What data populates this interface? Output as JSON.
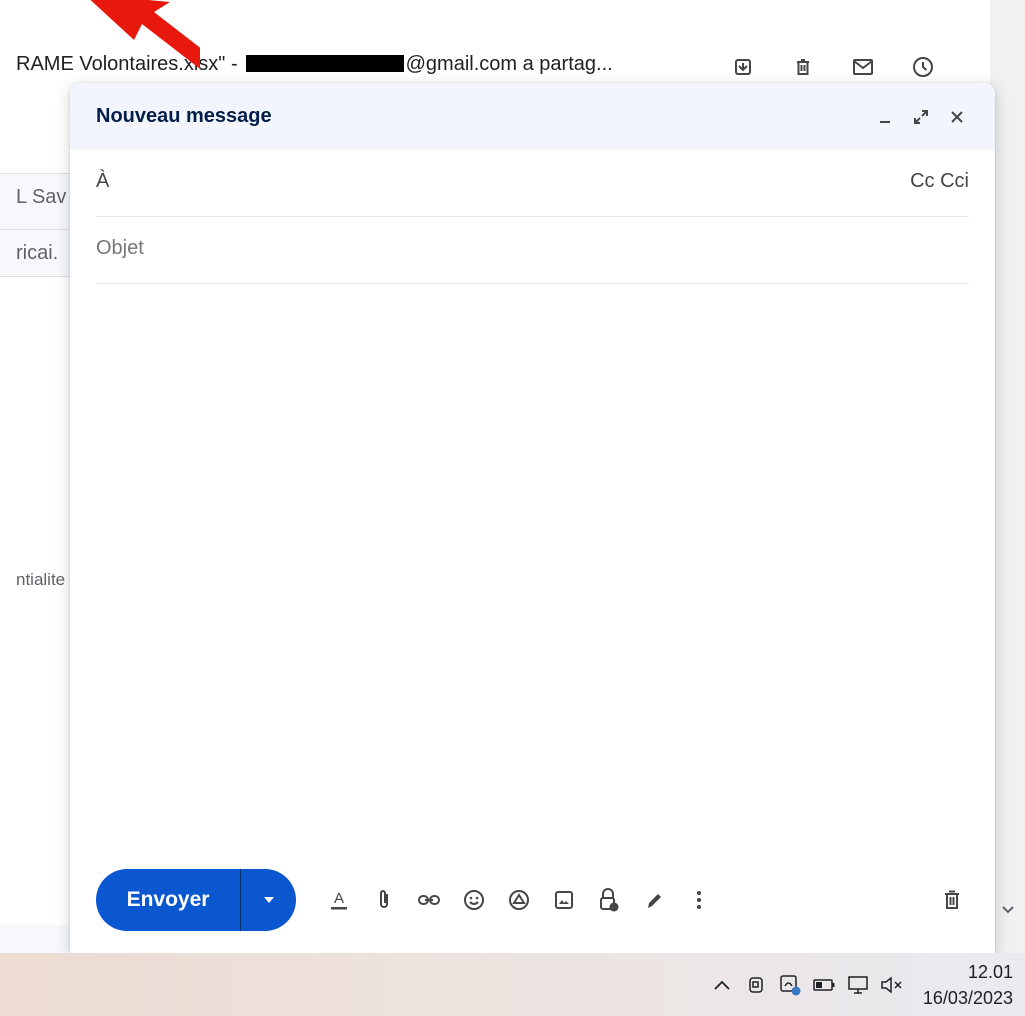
{
  "background": {
    "subject_prefix": "RAME Volontaires.xlsx\" -",
    "subject_suffix": "@gmail.com a partag...",
    "list_rows": [
      "L Sav",
      "ricai."
    ],
    "side_text": "ntialite"
  },
  "compose": {
    "title": "Nouveau message",
    "to_label": "À",
    "cc_cci": "Cc Cci",
    "subject_placeholder": "Objet",
    "send_label": "Envoyer"
  },
  "taskbar": {
    "time": "12.01",
    "date": "16/03/2023"
  },
  "colors": {
    "send_button": "#0b57d0",
    "compose_header": "#f2f6fc",
    "arrow": "#e8180c"
  },
  "icons": {
    "bg_actions": [
      "archive-icon",
      "trash-icon",
      "mail-icon",
      "clock-icon"
    ],
    "compose_header": [
      "minimize-icon",
      "expand-icon",
      "close-icon"
    ],
    "toolbar": [
      "text-format-icon",
      "attach-icon",
      "link-icon",
      "emoji-icon",
      "drive-icon",
      "photo-icon",
      "confidential-icon",
      "signature-icon",
      "more-options-icon",
      "discard-icon"
    ],
    "tray": [
      "chevron-up-icon",
      "camera-icon",
      "network-icon",
      "battery-icon",
      "display-icon",
      "mute-icon"
    ]
  }
}
